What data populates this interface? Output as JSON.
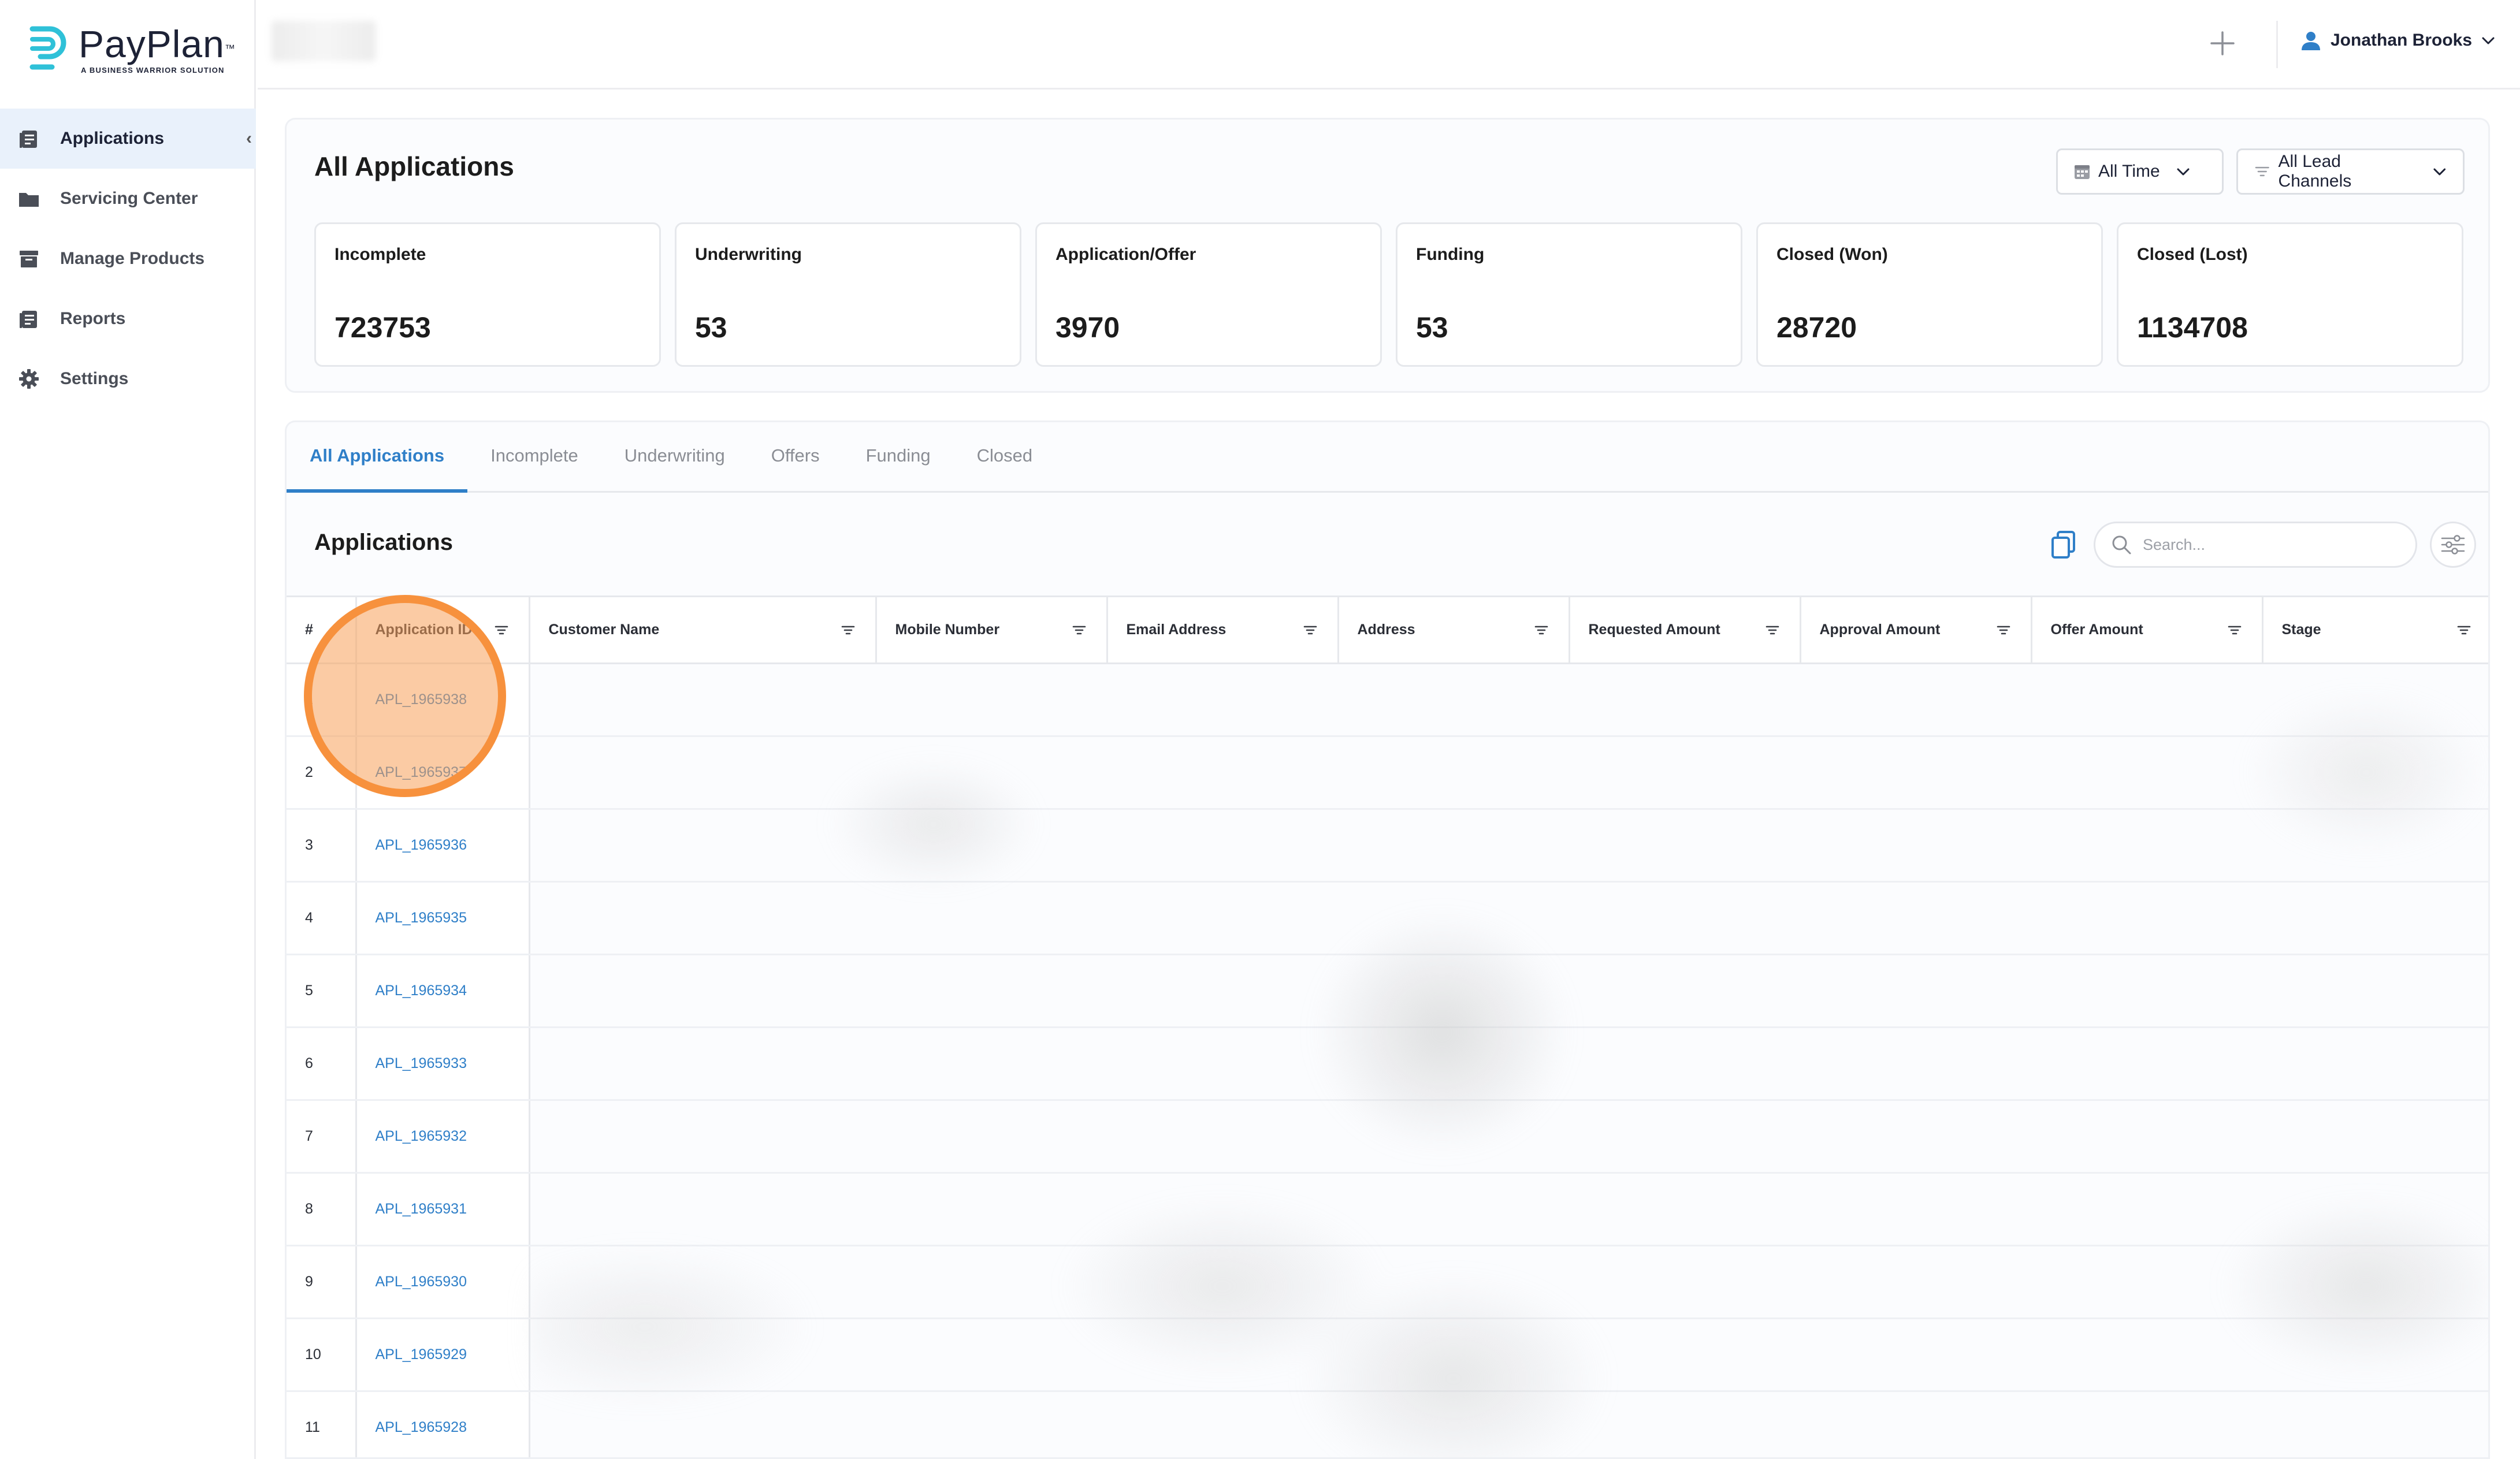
{
  "brand": {
    "name": "PayPlan",
    "trademark": "™",
    "tagline": "A BUSINESS WARRIOR SOLUTION",
    "accent": "#2fc1d8"
  },
  "sidebar": {
    "items": [
      {
        "label": "Applications",
        "icon": "applications-icon",
        "active": true
      },
      {
        "label": "Servicing Center",
        "icon": "folder-icon",
        "active": false
      },
      {
        "label": "Manage Products",
        "icon": "archive-icon",
        "active": false
      },
      {
        "label": "Reports",
        "icon": "reports-icon",
        "active": false
      },
      {
        "label": "Settings",
        "icon": "gear-icon",
        "active": false
      }
    ],
    "collapse_icon": "chevron-left-icon"
  },
  "topbar": {
    "add_icon": "plus-icon",
    "user_name": "Jonathan Brooks",
    "user_icon": "user-icon"
  },
  "summary": {
    "title": "All Applications",
    "time_filter": "All Time",
    "channel_filter": "All Lead Channels",
    "stats": [
      {
        "label": "Incomplete",
        "value": "723753"
      },
      {
        "label": "Underwriting",
        "value": "53"
      },
      {
        "label": "Application/Offer",
        "value": "3970"
      },
      {
        "label": "Funding",
        "value": "53"
      },
      {
        "label": "Closed (Won)",
        "value": "28720"
      },
      {
        "label": "Closed (Lost)",
        "value": "1134708"
      }
    ]
  },
  "tabs": [
    {
      "label": "All Applications",
      "active": true
    },
    {
      "label": "Incomplete",
      "active": false
    },
    {
      "label": "Underwriting",
      "active": false
    },
    {
      "label": "Offers",
      "active": false
    },
    {
      "label": "Funding",
      "active": false
    },
    {
      "label": "Closed",
      "active": false
    }
  ],
  "table": {
    "title": "Applications",
    "search_placeholder": "Search...",
    "columns": [
      "#",
      "Application ID",
      "Customer Name",
      "Mobile Number",
      "Email Address",
      "Address",
      "Requested Amount",
      "Approval Amount",
      "Offer Amount",
      "Stage"
    ],
    "rows": [
      {
        "num": "1",
        "id": "APL_1965938"
      },
      {
        "num": "2",
        "id": "APL_1965937"
      },
      {
        "num": "3",
        "id": "APL_1965936"
      },
      {
        "num": "4",
        "id": "APL_1965935"
      },
      {
        "num": "5",
        "id": "APL_1965934"
      },
      {
        "num": "6",
        "id": "APL_1965933"
      },
      {
        "num": "7",
        "id": "APL_1965932"
      },
      {
        "num": "8",
        "id": "APL_1965931"
      },
      {
        "num": "9",
        "id": "APL_1965930"
      },
      {
        "num": "10",
        "id": "APL_1965929"
      },
      {
        "num": "11",
        "id": "APL_1965928"
      }
    ]
  },
  "colors": {
    "primary": "#2f7fc8",
    "active_nav_bg": "#e9f1fb",
    "click_indicator": "#f7913d"
  }
}
